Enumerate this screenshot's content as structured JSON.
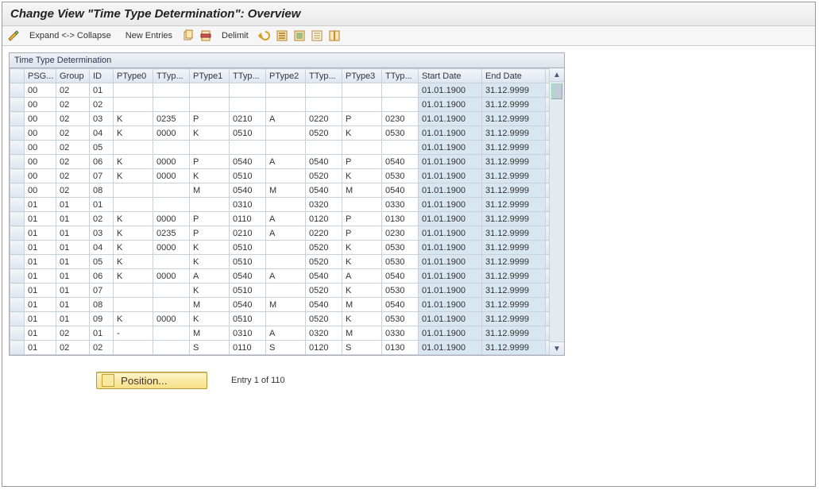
{
  "header": {
    "title": "Change View \"Time Type Determination\": Overview"
  },
  "toolbar": {
    "expand": "Expand <-> Collapse",
    "new_entries": "New Entries",
    "delimit": "Delimit"
  },
  "panel": {
    "title": "Time Type Determination"
  },
  "columns": [
    "PSG...",
    "Group",
    "ID",
    "PType0",
    "TTyp...",
    "PType1",
    "TTyp...",
    "PType2",
    "TTyp...",
    "PType3",
    "TTyp...",
    "Start Date",
    "End Date"
  ],
  "rows": [
    {
      "psg": "00",
      "grp": "02",
      "id": "01",
      "pt0": "",
      "tt0": "",
      "pt1": "",
      "tt1": "",
      "pt2": "",
      "tt2": "",
      "pt3": "",
      "tt3": "",
      "start": "01.01.1900",
      "end": "31.12.9999"
    },
    {
      "psg": "00",
      "grp": "02",
      "id": "02",
      "pt0": "",
      "tt0": "",
      "pt1": "",
      "tt1": "",
      "pt2": "",
      "tt2": "",
      "pt3": "",
      "tt3": "",
      "start": "01.01.1900",
      "end": "31.12.9999"
    },
    {
      "psg": "00",
      "grp": "02",
      "id": "03",
      "pt0": "K",
      "tt0": "0235",
      "pt1": "P",
      "tt1": "0210",
      "pt2": "A",
      "tt2": "0220",
      "pt3": "P",
      "tt3": "0230",
      "start": "01.01.1900",
      "end": "31.12.9999"
    },
    {
      "psg": "00",
      "grp": "02",
      "id": "04",
      "pt0": "K",
      "tt0": "0000",
      "pt1": "K",
      "tt1": "0510",
      "pt2": "",
      "tt2": "0520",
      "pt3": "K",
      "tt3": "0530",
      "start": "01.01.1900",
      "end": "31.12.9999"
    },
    {
      "psg": "00",
      "grp": "02",
      "id": "05",
      "pt0": "",
      "tt0": "",
      "pt1": "",
      "tt1": "",
      "pt2": "",
      "tt2": "",
      "pt3": "",
      "tt3": "",
      "start": "01.01.1900",
      "end": "31.12.9999"
    },
    {
      "psg": "00",
      "grp": "02",
      "id": "06",
      "pt0": "K",
      "tt0": "0000",
      "pt1": "P",
      "tt1": "0540",
      "pt2": "A",
      "tt2": "0540",
      "pt3": "P",
      "tt3": "0540",
      "start": "01.01.1900",
      "end": "31.12.9999"
    },
    {
      "psg": "00",
      "grp": "02",
      "id": "07",
      "pt0": "K",
      "tt0": "0000",
      "pt1": "K",
      "tt1": "0510",
      "pt2": "",
      "tt2": "0520",
      "pt3": "K",
      "tt3": "0530",
      "start": "01.01.1900",
      "end": "31.12.9999"
    },
    {
      "psg": "00",
      "grp": "02",
      "id": "08",
      "pt0": "",
      "tt0": "",
      "pt1": "M",
      "tt1": "0540",
      "pt2": "M",
      "tt2": "0540",
      "pt3": "M",
      "tt3": "0540",
      "start": "01.01.1900",
      "end": "31.12.9999"
    },
    {
      "psg": "01",
      "grp": "01",
      "id": "01",
      "pt0": "",
      "tt0": "",
      "pt1": "",
      "tt1": "0310",
      "pt2": "",
      "tt2": "0320",
      "pt3": "",
      "tt3": "0330",
      "start": "01.01.1900",
      "end": "31.12.9999"
    },
    {
      "psg": "01",
      "grp": "01",
      "id": "02",
      "pt0": "K",
      "tt0": "0000",
      "pt1": "P",
      "tt1": "0110",
      "pt2": "A",
      "tt2": "0120",
      "pt3": "P",
      "tt3": "0130",
      "start": "01.01.1900",
      "end": "31.12.9999"
    },
    {
      "psg": "01",
      "grp": "01",
      "id": "03",
      "pt0": "K",
      "tt0": "0235",
      "pt1": "P",
      "tt1": "0210",
      "pt2": "A",
      "tt2": "0220",
      "pt3": "P",
      "tt3": "0230",
      "start": "01.01.1900",
      "end": "31.12.9999"
    },
    {
      "psg": "01",
      "grp": "01",
      "id": "04",
      "pt0": "K",
      "tt0": "0000",
      "pt1": "K",
      "tt1": "0510",
      "pt2": "",
      "tt2": "0520",
      "pt3": "K",
      "tt3": "0530",
      "start": "01.01.1900",
      "end": "31.12.9999"
    },
    {
      "psg": "01",
      "grp": "01",
      "id": "05",
      "pt0": "K",
      "tt0": "",
      "pt1": "K",
      "tt1": "0510",
      "pt2": "",
      "tt2": "0520",
      "pt3": "K",
      "tt3": "0530",
      "start": "01.01.1900",
      "end": "31.12.9999"
    },
    {
      "psg": "01",
      "grp": "01",
      "id": "06",
      "pt0": "K",
      "tt0": "0000",
      "pt1": "A",
      "tt1": "0540",
      "pt2": "A",
      "tt2": "0540",
      "pt3": "A",
      "tt3": "0540",
      "start": "01.01.1900",
      "end": "31.12.9999"
    },
    {
      "psg": "01",
      "grp": "01",
      "id": "07",
      "pt0": "",
      "tt0": "",
      "pt1": "K",
      "tt1": "0510",
      "pt2": "",
      "tt2": "0520",
      "pt3": "K",
      "tt3": "0530",
      "start": "01.01.1900",
      "end": "31.12.9999"
    },
    {
      "psg": "01",
      "grp": "01",
      "id": "08",
      "pt0": "",
      "tt0": "",
      "pt1": "M",
      "tt1": "0540",
      "pt2": "M",
      "tt2": "0540",
      "pt3": "M",
      "tt3": "0540",
      "start": "01.01.1900",
      "end": "31.12.9999"
    },
    {
      "psg": "01",
      "grp": "01",
      "id": "09",
      "pt0": "K",
      "tt0": "0000",
      "pt1": "K",
      "tt1": "0510",
      "pt2": "",
      "tt2": "0520",
      "pt3": "K",
      "tt3": "0530",
      "start": "01.01.1900",
      "end": "31.12.9999"
    },
    {
      "psg": "01",
      "grp": "02",
      "id": "01",
      "pt0": "-",
      "tt0": "",
      "pt1": "M",
      "tt1": "0310",
      "pt2": "A",
      "tt2": "0320",
      "pt3": "M",
      "tt3": "0330",
      "start": "01.01.1900",
      "end": "31.12.9999"
    },
    {
      "psg": "01",
      "grp": "02",
      "id": "02",
      "pt0": "",
      "tt0": "",
      "pt1": "S",
      "tt1": "0110",
      "pt2": "S",
      "tt2": "0120",
      "pt3": "S",
      "tt3": "0130",
      "start": "01.01.1900",
      "end": "31.12.9999"
    }
  ],
  "footer": {
    "position_label": "Position...",
    "entry_status": "Entry 1 of 110"
  }
}
